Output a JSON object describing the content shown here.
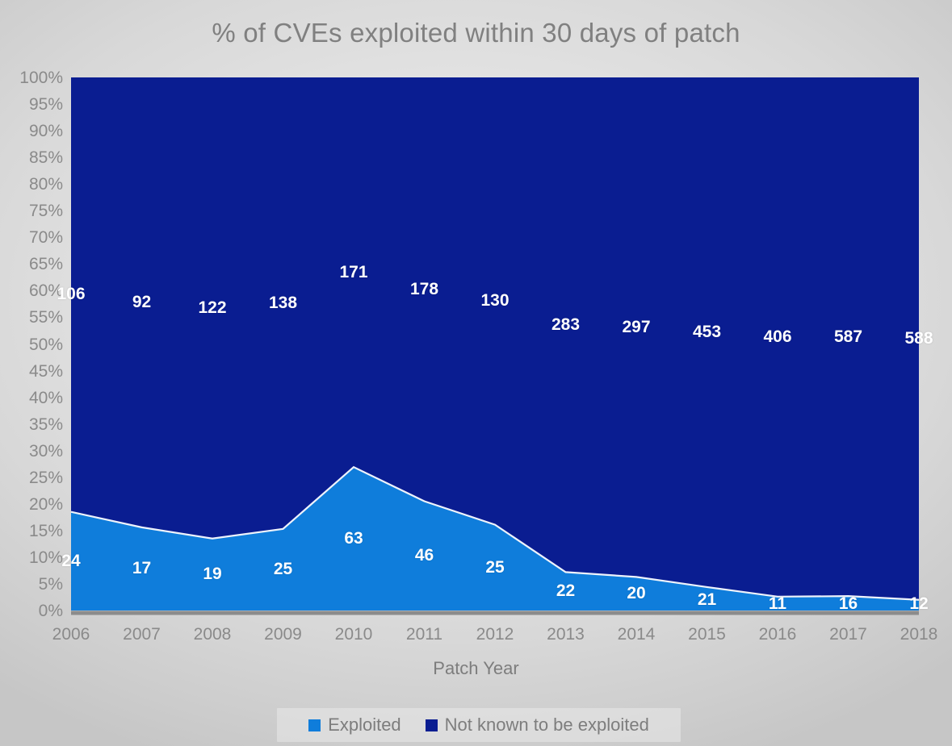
{
  "chart_data": {
    "type": "area",
    "title": "% of CVEs exploited within 30 days of patch",
    "subtitle": "",
    "xlabel": "Patch Year",
    "ylabel": "",
    "stacked": true,
    "normalized": true,
    "grid": false,
    "legend_position": "bottom",
    "ylim": [
      0,
      100
    ],
    "ytick_labels": [
      "100%",
      "95%",
      "90%",
      "85%",
      "80%",
      "75%",
      "70%",
      "65%",
      "60%",
      "55%",
      "50%",
      "45%",
      "40%",
      "35%",
      "30%",
      "25%",
      "20%",
      "15%",
      "10%",
      "5%",
      "0%"
    ],
    "ytick_values": [
      100,
      95,
      90,
      85,
      80,
      75,
      70,
      65,
      60,
      55,
      50,
      45,
      40,
      35,
      30,
      25,
      20,
      15,
      10,
      5,
      0
    ],
    "categories": [
      "2006",
      "2007",
      "2008",
      "2009",
      "2010",
      "2011",
      "2012",
      "2013",
      "2014",
      "2015",
      "2016",
      "2017",
      "2018"
    ],
    "series": [
      {
        "name": "Exploited",
        "color": "#0f7ddb",
        "values": [
          24,
          17,
          19,
          25,
          63,
          46,
          25,
          22,
          20,
          21,
          11,
          16,
          12
        ],
        "percents": [
          18.5,
          15.6,
          13.5,
          15.3,
          26.9,
          20.5,
          16.1,
          7.2,
          6.3,
          4.4,
          2.6,
          2.7,
          2.0
        ]
      },
      {
        "name": "Not known to be exploited",
        "color": "#0a1d91",
        "values": [
          106,
          92,
          122,
          138,
          171,
          178,
          130,
          283,
          297,
          453,
          406,
          587,
          588
        ],
        "percents": [
          81.5,
          84.4,
          86.5,
          84.7,
          73.1,
          79.5,
          83.9,
          92.8,
          93.7,
          95.6,
          97.4,
          97.3,
          98.0
        ]
      }
    ]
  },
  "legend": {
    "items": [
      {
        "label": "Exploited",
        "color": "#0f7ddb"
      },
      {
        "label": "Not known to be exploited",
        "color": "#0a1d91"
      }
    ]
  },
  "colors": {
    "exploited": "#0f7ddb",
    "not_exploited": "#0a1d91",
    "title_text": "#808080",
    "axis_text": "#8a8a8a",
    "label_text": "#ffffff",
    "background": "#e4e4e4",
    "axis_line": "#8c8c8c"
  }
}
